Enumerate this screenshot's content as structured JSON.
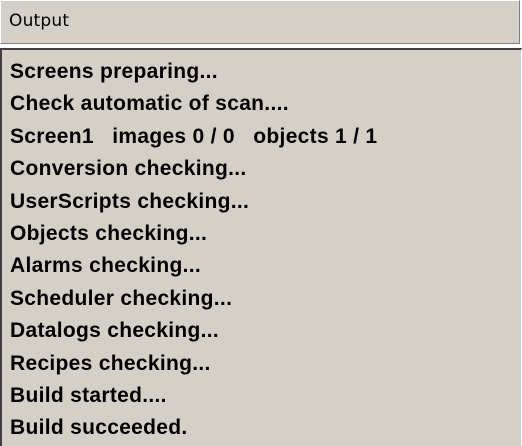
{
  "panel": {
    "title": "Output"
  },
  "output": {
    "lines": [
      "Screens preparing...",
      "Check automatic of scan....",
      "Screen1   images 0 / 0   objects 1 / 1",
      "Conversion checking...",
      "UserScripts checking...",
      "Objects checking...",
      "Alarms checking...",
      "Scheduler checking...",
      "Datalogs checking...",
      "Recipes checking...",
      "Build started....",
      "Build succeeded."
    ]
  },
  "colors": {
    "panel_background": "#d4d0c8",
    "text": "#000000"
  }
}
